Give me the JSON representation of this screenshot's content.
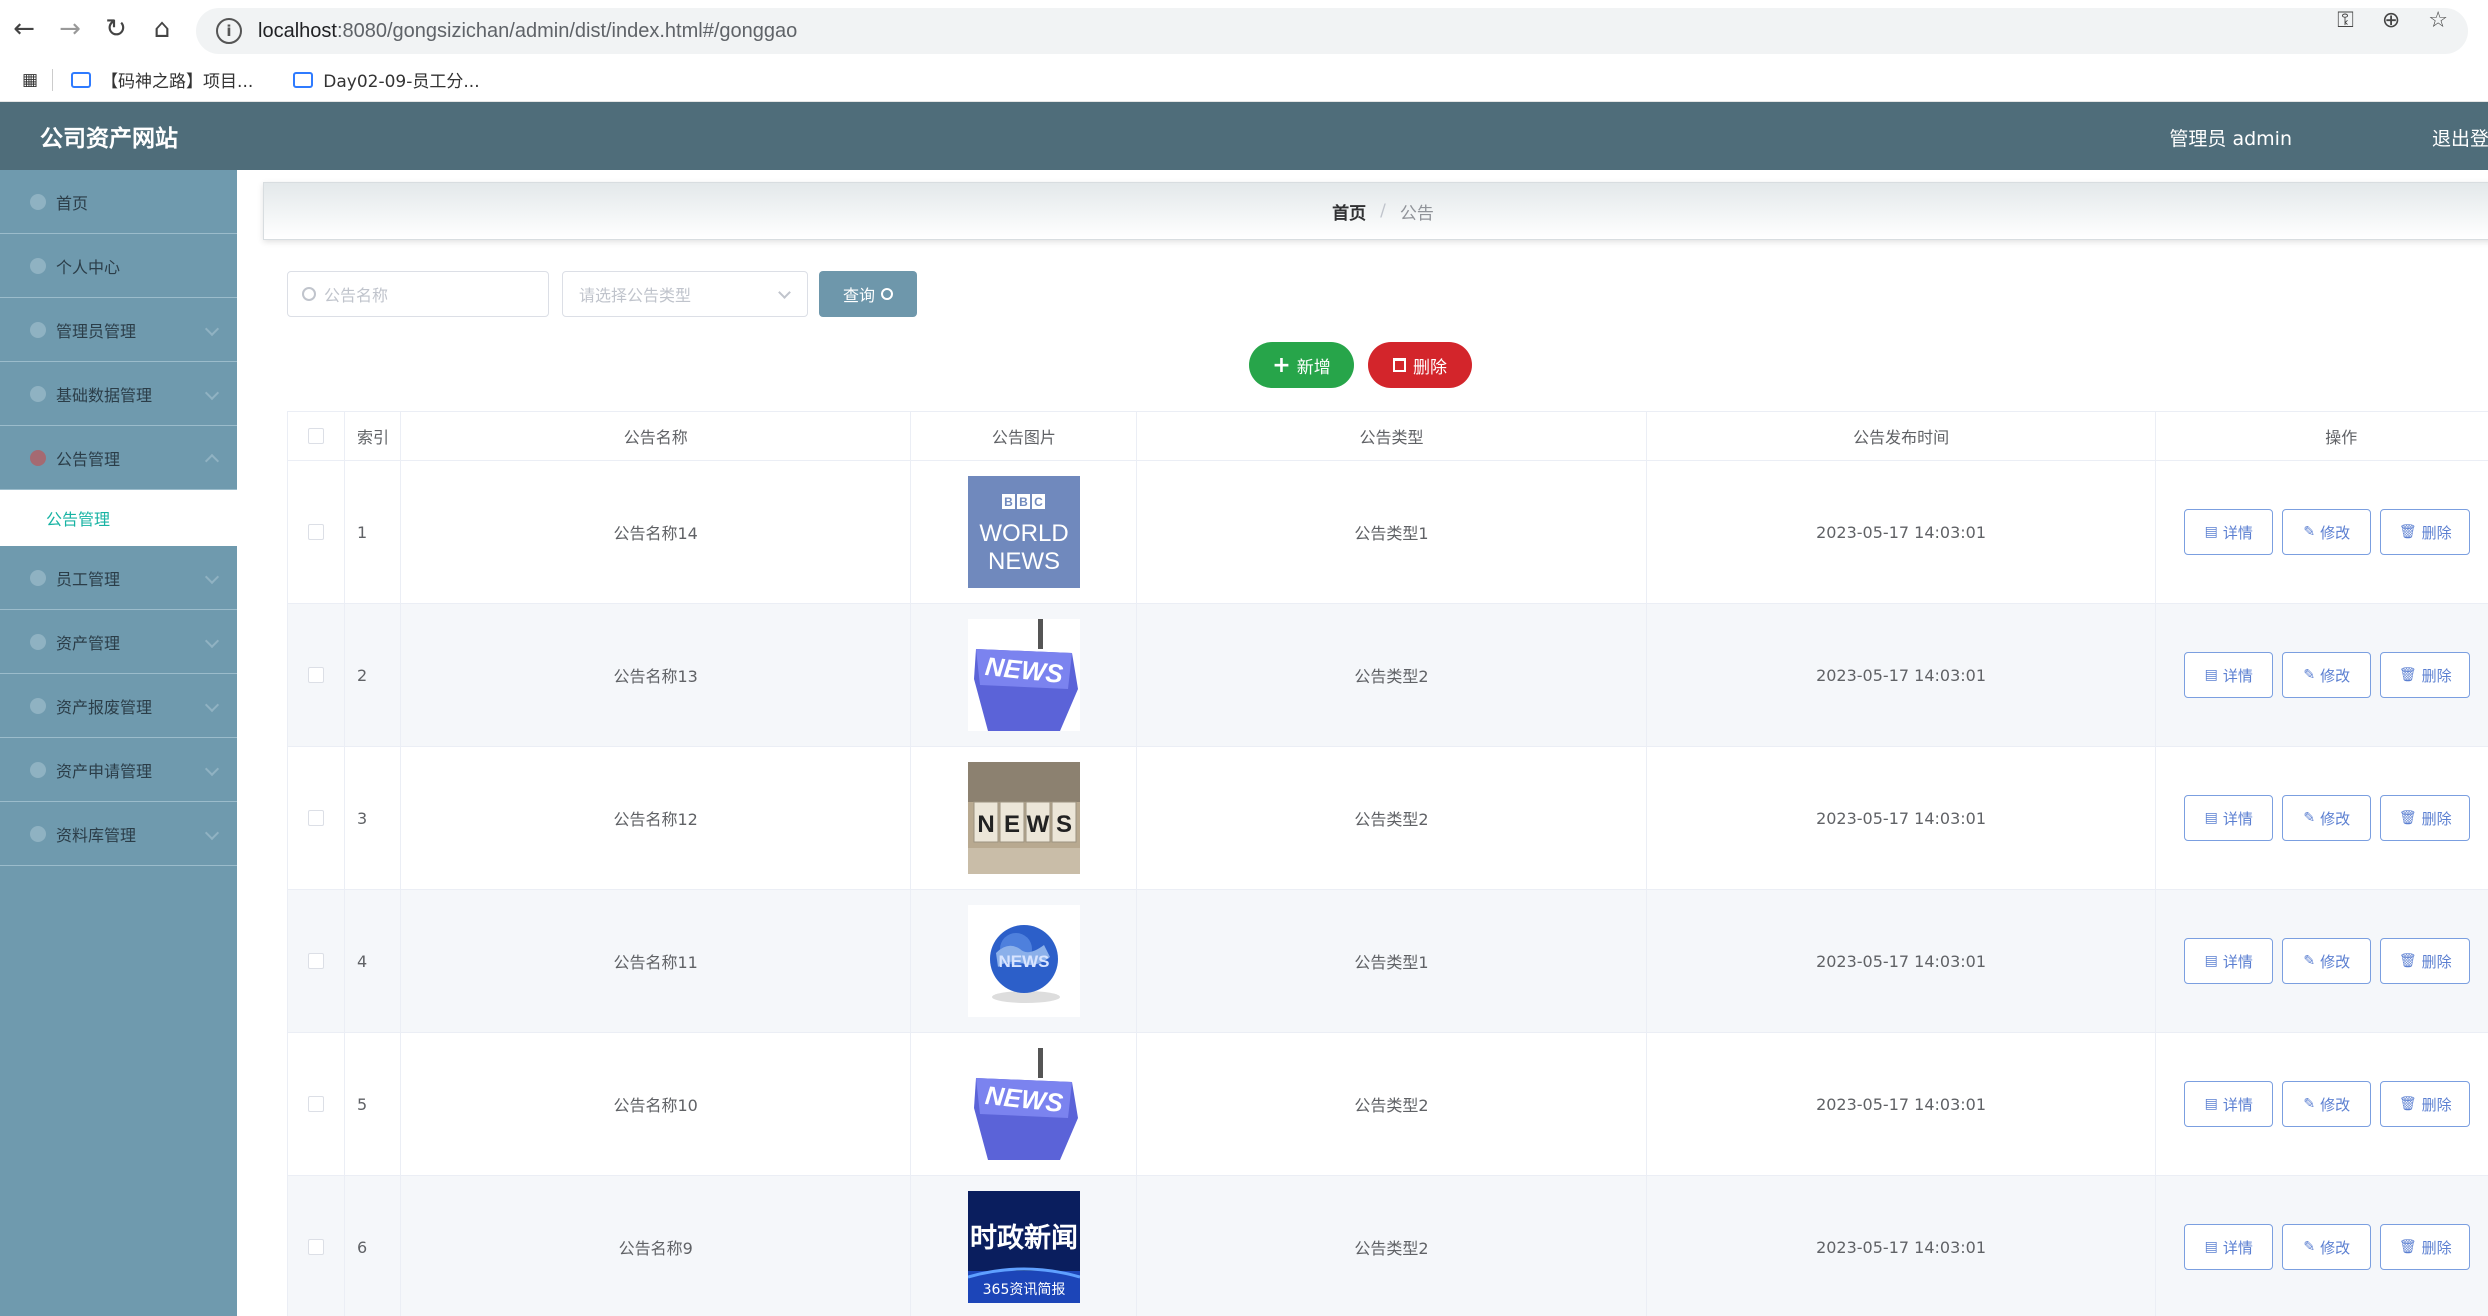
{
  "browser": {
    "url_host": "localhost",
    "url_path": ":8080/gongsizichan/admin/dist/index.html#/gonggao",
    "bookmarks": [
      "【码神之路】项目...",
      "Day02-09-员工分..."
    ]
  },
  "header": {
    "title": "公司资产网站",
    "user": "管理员 admin",
    "logout": "退出登录"
  },
  "sidebar": {
    "items": [
      {
        "label": "首页"
      },
      {
        "label": "个人中心"
      },
      {
        "label": "管理员管理"
      },
      {
        "label": "基础数据管理"
      },
      {
        "label": "公告管理"
      },
      {
        "label": "员工管理"
      },
      {
        "label": "资产管理"
      },
      {
        "label": "资产报废管理"
      },
      {
        "label": "资产申请管理"
      },
      {
        "label": "资料库管理"
      }
    ],
    "active_sub": "公告管理"
  },
  "breadcrumb": {
    "home": "首页",
    "sep": "/",
    "current": "公告"
  },
  "search": {
    "name_placeholder": "公告名称",
    "type_placeholder": "请选择公告类型",
    "query_label": "查询"
  },
  "actions": {
    "add_label": "新增",
    "delete_label": "删除"
  },
  "table": {
    "headers": [
      "索引",
      "公告名称",
      "公告图片",
      "公告类型",
      "公告发布时间",
      "操作"
    ],
    "op_labels": {
      "detail": "详情",
      "edit": "修改",
      "delete": "删除"
    },
    "rows": [
      {
        "index": "1",
        "name": "公告名称14",
        "image": "bbc-world-news",
        "type": "公告类型1",
        "time": "2023-05-17 14:03:01"
      },
      {
        "index": "2",
        "name": "公告名称13",
        "image": "news-key",
        "type": "公告类型2",
        "time": "2023-05-17 14:03:01"
      },
      {
        "index": "3",
        "name": "公告名称12",
        "image": "news-blocks",
        "type": "公告类型2",
        "time": "2023-05-17 14:03:01"
      },
      {
        "index": "4",
        "name": "公告名称11",
        "image": "news-globe",
        "type": "公告类型1",
        "time": "2023-05-17 14:03:01"
      },
      {
        "index": "5",
        "name": "公告名称10",
        "image": "news-key",
        "type": "公告类型2",
        "time": "2023-05-17 14:03:01"
      },
      {
        "index": "6",
        "name": "公告名称9",
        "image": "shizheng-xinwen",
        "type": "公告类型2",
        "time": "2023-05-17 14:03:01"
      }
    ]
  },
  "image_text": {
    "bbc": "BBC",
    "world": "WORLD",
    "news": "NEWS",
    "news_blocks": [
      "N",
      "E",
      "W",
      "S"
    ],
    "shizheng": "时政新闻",
    "shizheng_sub": "365资讯简报"
  },
  "colors": {
    "header": "#4f6d7a",
    "sidebar": "#6f9aae",
    "active": "#17b3a3",
    "add": "#27a54a",
    "delete": "#d3252b",
    "op_border": "#7b9fe0"
  }
}
